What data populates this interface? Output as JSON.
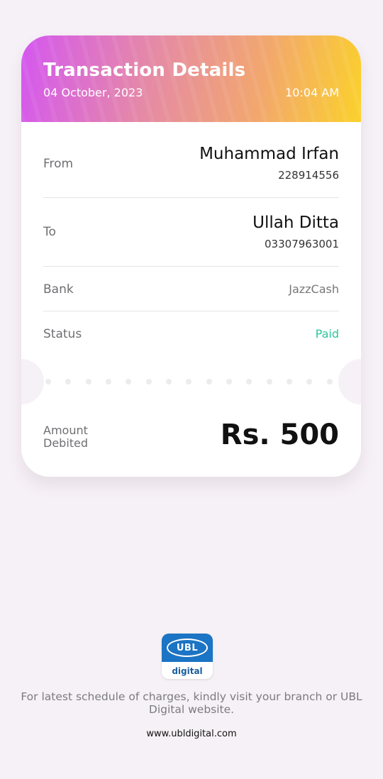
{
  "header": {
    "title": "Transaction Details",
    "date": "04 October, 2023",
    "time": "10:04 AM"
  },
  "from": {
    "label": "From",
    "name": "Muhammad Irfan",
    "account": "228914556"
  },
  "to": {
    "label": "To",
    "name": "Ullah Ditta",
    "account": "03307963001"
  },
  "bank": {
    "label": "Bank",
    "value": "JazzCash"
  },
  "status": {
    "label": "Status",
    "value": "Paid",
    "color": "#2bc69a"
  },
  "amount": {
    "label_line1": "Amount",
    "label_line2": "Debited",
    "value": "Rs. 500"
  },
  "logo": {
    "brand": "UBL",
    "sub": "digital"
  },
  "footer": {
    "note": "For latest schedule of charges, kindly visit your branch or UBL Digital website.",
    "url": "www.ubldigital.com"
  },
  "colors": {
    "gradient_start": "#d457f0",
    "gradient_end": "#fbd12b",
    "ubl_blue": "#1b74c4"
  }
}
